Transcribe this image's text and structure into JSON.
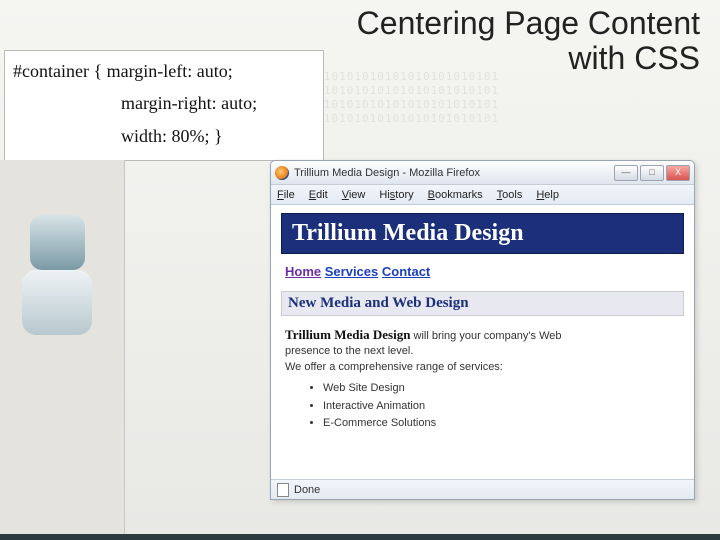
{
  "bg_pattern": "0101010101010101010101010101010101\n0101010101010101010101010101010101\n0101010101010101010101010101010101\n0101010101010101010101010101010101",
  "slide": {
    "title_line1": "Centering Page Content",
    "title_line2": "with CSS"
  },
  "code": {
    "line1": "#container { margin-left: auto;",
    "line2": "margin-right: auto;",
    "line3": "width: 80%; }"
  },
  "browser": {
    "title": "Trillium Media Design - Mozilla Firefox",
    "win_min": "—",
    "win_max": "□",
    "win_close": "X",
    "menu": {
      "file": "File",
      "edit": "Edit",
      "view": "View",
      "history": "History",
      "bookmarks": "Bookmarks",
      "tools": "Tools",
      "help": "Help"
    },
    "status": "Done"
  },
  "page": {
    "banner": "Trillium Media Design",
    "nav": {
      "home": "Home",
      "services": "Services",
      "contact": "Contact"
    },
    "subheading": "New Media and Web Design",
    "lead_bold": "Trillium Media Design",
    "lead_rest": " will bring your company's Web",
    "lead_line2": "presence to the next level.",
    "lead_line3": "We offer a comprehensive range of services:",
    "services": [
      "Web Site Design",
      "Interactive Animation",
      "E-Commerce Solutions"
    ]
  }
}
